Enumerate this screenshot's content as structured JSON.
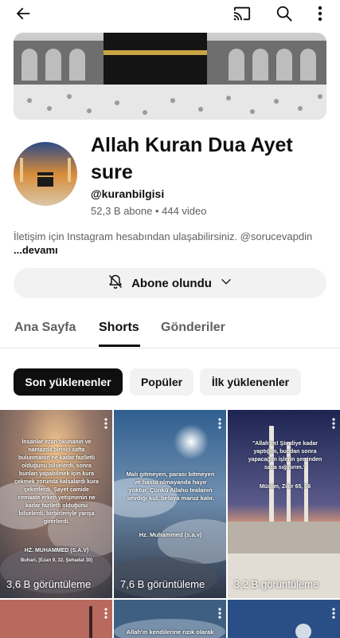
{
  "icons": {
    "back": "back-arrow-icon",
    "cast": "cast-icon",
    "search": "search-icon",
    "more": "more-vertical-icon",
    "bell": "bell-off-icon",
    "chevron": "chevron-down-icon"
  },
  "channel": {
    "name": "Allah Kuran Dua Ayet sure",
    "handle": "@kuranbilgisi",
    "stats": "52,3 B abone • 444 video",
    "description": "İletişim için Instagram hesabından ulaşabilirsiniz. @sorucevapdin",
    "more_label": "...devamı"
  },
  "subscribe": {
    "label": "Abone olundu"
  },
  "tabs": [
    "Ana Sayfa",
    "Shorts",
    "Gönderiler"
  ],
  "filters": [
    "Son yüklenenler",
    "Popüler",
    "İlk yüklenenler"
  ],
  "shorts": [
    {
      "views": "3,6 B görüntüleme",
      "text": "İnsanlar ezan okunanın ve namazda birinci safta bulunmanın ne kadar fazîletli olduğunu bilselerdi, sonra bunları yapabilmek için kura çekmek zorunda kalsalardı kura çekerlerdi. Şayet camide cemaate erken yetişmenin ne kadar fazîletli olduğunu bilselerdi, birbirleriyle yarışa girerlerdi.",
      "caption": "HZ. MUHAMMED (S.A.V)",
      "source": "Buhari, (Ezan 9, 32, Şehadat 30)"
    },
    {
      "views": "7,6 B görüntüleme",
      "text": "Malı gitmeyen, parası bitmeyen ve hasta olmayanda hayır yoktur. Çünkü Allahu tealanın sevdiği kul, belaya maruz kalır.",
      "caption": "Hz. Muhammed (s.a.v)",
      "source": ""
    },
    {
      "views": "3,2 B görüntüleme",
      "text": "\"Allah'ım! Şimdiye kadar yaptığım, bundan sonra yapacağım işlerin şerrinden sana sığınırım.\"",
      "caption": "Müslim, Zikir 65, 66",
      "source": ""
    }
  ],
  "row2": [
    {
      "text": ""
    },
    {
      "text": "Allah'ın kendilerine rızık olarak"
    },
    {
      "text": ""
    }
  ]
}
